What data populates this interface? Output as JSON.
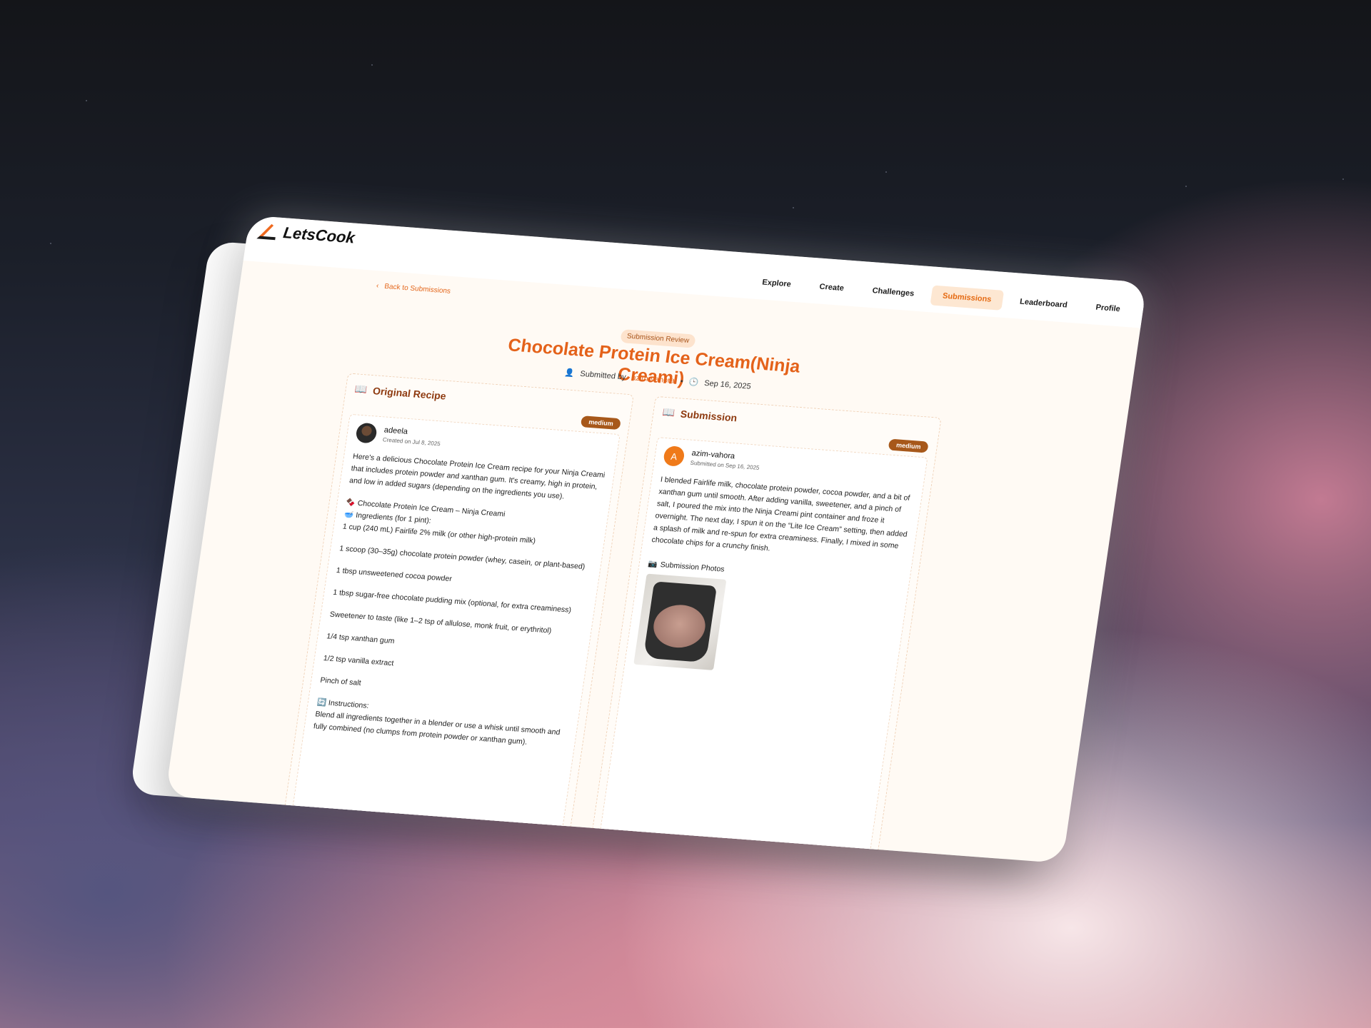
{
  "app": {
    "brand": "LetsCook"
  },
  "nav": {
    "items": [
      {
        "label": "Explore",
        "active": false
      },
      {
        "label": "Create",
        "active": false
      },
      {
        "label": "Challenges",
        "active": false
      },
      {
        "label": "Submissions",
        "active": true
      },
      {
        "label": "Leaderboard",
        "active": false
      },
      {
        "label": "Profile",
        "active": false
      }
    ]
  },
  "back_link": "Back to Submissions",
  "header": {
    "badge": "Submission Review",
    "title": "Chocolate Protein Ice Cream(Ninja Creami)",
    "submitted_by_label": "Submitted by",
    "submitted_by_user": "azim-vahora",
    "date": "Sep 16, 2025"
  },
  "original": {
    "heading": "Original Recipe",
    "difficulty": "medium",
    "author": "adeela",
    "created": "Created on Jul 8, 2025",
    "intro": "Here's a delicious Chocolate Protein Ice Cream recipe for your Ninja Creami that includes protein powder and xanthan gum. It's creamy, high in protein, and low in added sugars (depending on the ingredients you use).",
    "recipe_title": "Chocolate Protein Ice Cream – Ninja Creami",
    "ingredients_heading": "Ingredients (for 1 pint):",
    "ingredients": [
      "1 cup (240 mL) Fairlife 2% milk (or other high-protein milk)",
      "1 scoop (30–35g) chocolate protein powder (whey, casein, or plant-based)",
      "1 tbsp unsweetened cocoa powder",
      "1 tbsp sugar-free chocolate pudding mix (optional, for extra creaminess)",
      "Sweetener to taste (like 1–2 tsp of allulose, monk fruit, or erythritol)",
      "1/4 tsp xanthan gum",
      "1/2 tsp vanilla extract",
      "Pinch of salt"
    ],
    "instructions_heading": "Instructions:",
    "instructions_first": "Blend all ingredients together in a blender or use a whisk until smooth and fully combined (no clumps from protein powder or xanthan gum)."
  },
  "submission": {
    "heading": "Submission",
    "difficulty": "medium",
    "avatar_letter": "A",
    "author": "azim-vahora",
    "submitted": "Submitted on Sep 16, 2025",
    "text": "I blended Fairlife milk, chocolate protein powder, cocoa powder, and a bit of xanthan gum until smooth. After adding vanilla, sweetener, and a pinch of salt, I poured the mix into the Ninja Creami pint container and froze it overnight. The next day, I spun it on the “Lite Ice Cream” setting, then added a splash of milk and re-spun for extra creaminess. Finally, I mixed in some chocolate chips for a crunchy finish.",
    "photos_label": "Submission Photos"
  },
  "colors": {
    "accent": "#e4621a",
    "badge_bg": "#a7581a",
    "nav_active_bg": "#fde7d2"
  }
}
